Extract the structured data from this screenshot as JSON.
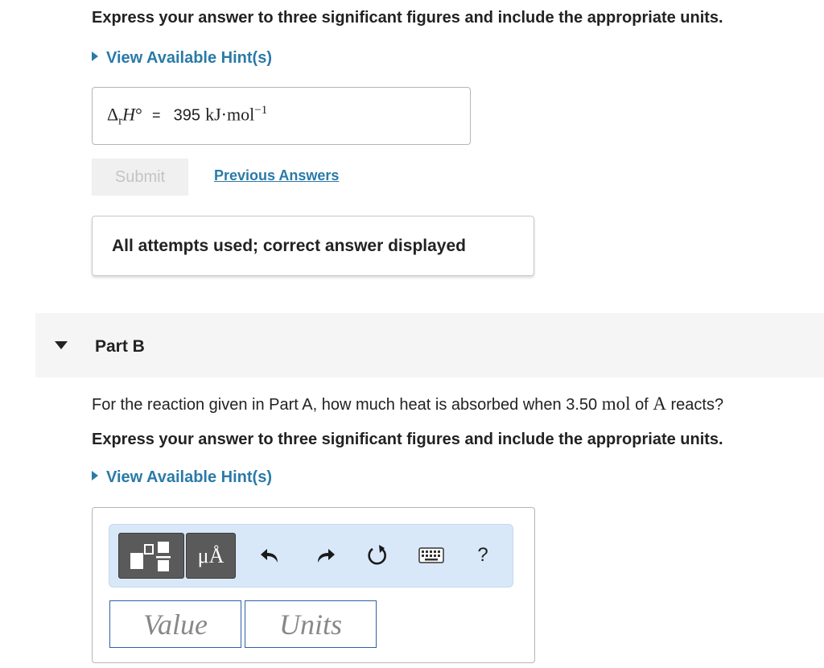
{
  "part_a": {
    "instruction": "Express your answer to three significant figures and include the appropriate units.",
    "hint_label": "View Available Hint(s)",
    "answer_symbol": "Δ",
    "answer_subscript": "r",
    "answer_var": "H",
    "answer_degree": "°",
    "answer_equals": "=",
    "answer_value": "395",
    "answer_units": "kJ·mol",
    "answer_exponent": "−1",
    "submit_label": "Submit",
    "previous_answers_label": "Previous Answers",
    "status_message": "All attempts used; correct answer displayed"
  },
  "part_b": {
    "title": "Part B",
    "question_prefix": "For the reaction given in Part A, how much heat is absorbed when 3.50",
    "question_mol": "mol",
    "question_of": "of",
    "question_a": "A",
    "question_suffix": "reacts?",
    "instruction": "Express your answer to three significant figures and include the appropriate units.",
    "hint_label": "View Available Hint(s)",
    "toolbar": {
      "units_button_label": "μÅ",
      "help_label": "?"
    },
    "value_placeholder": "Value",
    "units_placeholder": "Units"
  },
  "colors": {
    "link": "#2a7aa8",
    "toolbar_bg": "#d9e8f9",
    "input_border": "#2f5fa8"
  }
}
